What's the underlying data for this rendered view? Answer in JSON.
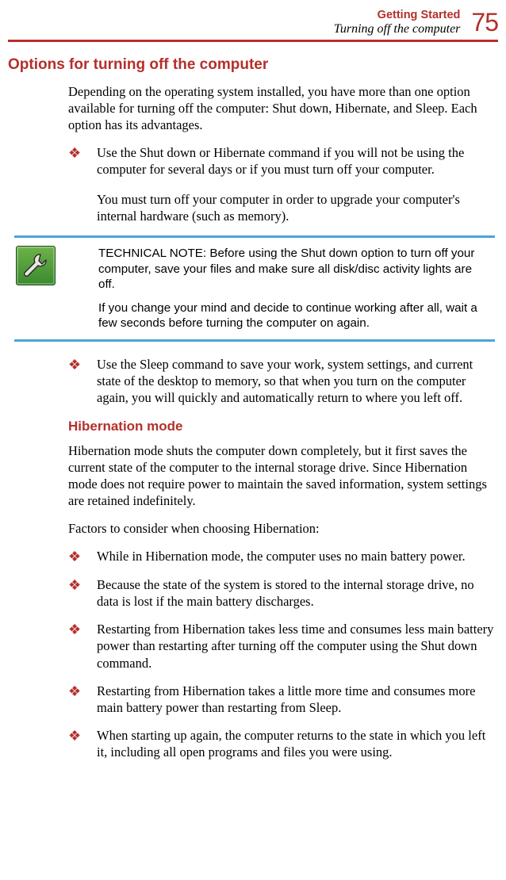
{
  "header": {
    "chapter": "Getting Started",
    "section": "Turning off the computer",
    "page_number": "75"
  },
  "headings": {
    "h2_options": "Options for turning off the computer",
    "h3_hibernation": "Hibernation mode"
  },
  "paragraphs": {
    "intro": "Depending on the operating system installed, you have more than one option available for turning off the computer: Shut down, Hibernate, and Sleep. Each option has its advantages.",
    "shutdown_upgrade": "You must turn off your computer in order to upgrade your computer's internal hardware (such as memory).",
    "hibernation_desc": "Hibernation mode shuts the computer down completely, but it first saves the current state of the computer to the internal storage drive. Since Hibernation mode does not require power to maintain the saved information, system settings are retained indefinitely.",
    "hibernation_factors": "Factors to consider when choosing Hibernation:"
  },
  "bullets_top": [
    "Use the Shut down or Hibernate command if you will not be using the computer for several days or if you must turn off your computer."
  ],
  "bullets_mid": [
    "Use the Sleep command to save your work, system settings, and current state of the desktop to memory, so that when you turn on the computer again, you will quickly and automatically return to where you left off."
  ],
  "bullets_hib": [
    "While in Hibernation mode, the computer uses no main battery power.",
    "Because the state of the system is stored to the internal storage drive, no data is lost if the main battery discharges.",
    "Restarting from Hibernation takes less time and consumes less main battery power than restarting after turning off the computer using the Shut down command.",
    "Restarting from Hibernation takes a little more time and consumes more main battery power than restarting from Sleep.",
    "When starting up again, the computer returns to the state in which you left it, including all open programs and files you were using."
  ],
  "note": {
    "p1": "TECHNICAL NOTE: Before using the Shut down option to turn off your computer, save your files and make sure all disk/disc activity lights are off.",
    "p2": "If you change your mind and decide to continue working after all, wait a few seconds before turning the computer on again."
  },
  "bullet_glyph": "❖",
  "icon_name": "wrench-icon"
}
